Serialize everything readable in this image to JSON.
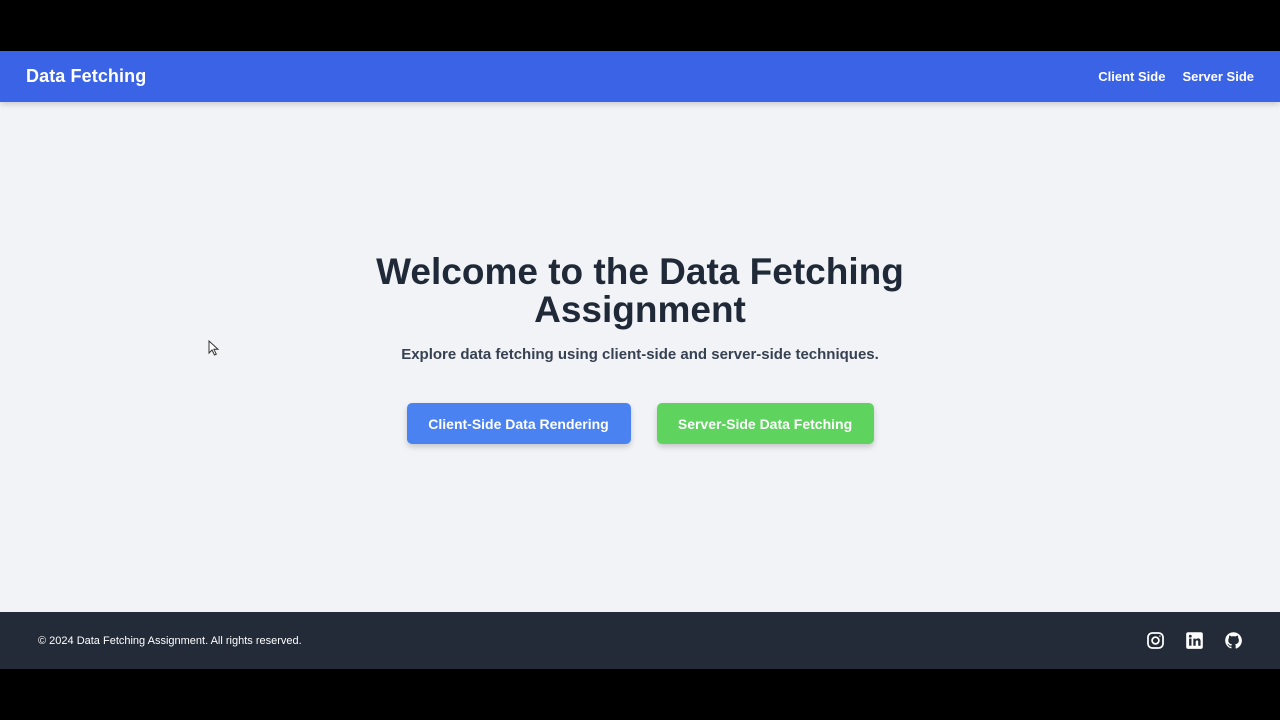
{
  "navbar": {
    "brand": "Data Fetching",
    "links": [
      {
        "label": "Client Side"
      },
      {
        "label": "Server Side"
      }
    ],
    "background": "#3b63e6"
  },
  "hero": {
    "title": "Welcome to the Data Fetching Assignment",
    "subtitle": "Explore data fetching using client-side and server-side techniques.",
    "buttons": {
      "client": {
        "label": "Client-Side Data Rendering",
        "color": "#4a82f2"
      },
      "server": {
        "label": "Server-Side Data Fetching",
        "color": "#5ed45e"
      }
    }
  },
  "footer": {
    "copyright": "© 2024 Data Fetching Assignment. All rights reserved.",
    "social_icons": [
      "instagram-icon",
      "linkedin-icon",
      "github-icon"
    ],
    "background": "#232b38"
  }
}
